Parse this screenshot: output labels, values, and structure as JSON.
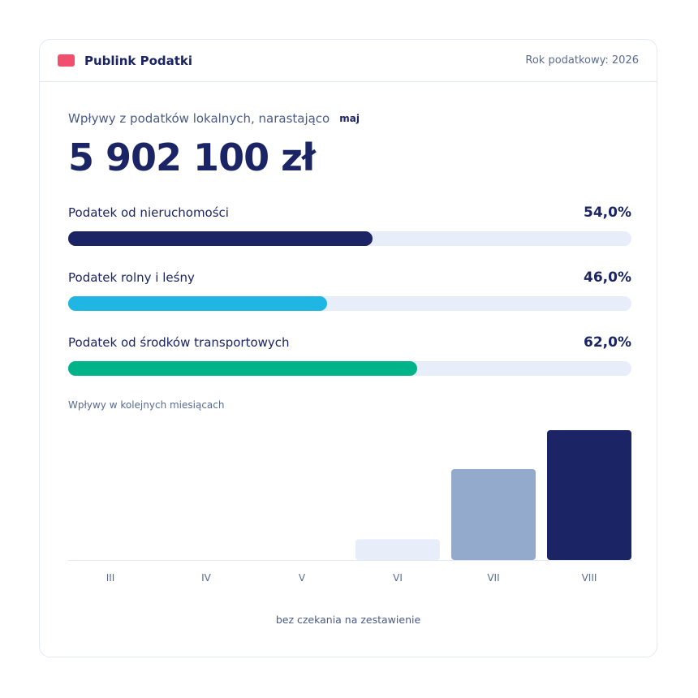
{
  "header": {
    "brand": "Publink Podatki",
    "tax_year": "Rok podatkowy: 2026"
  },
  "summary": {
    "label": "Wpływy z podatków lokalnych, narastająco",
    "month": "maj",
    "total": "5 902 100 zł"
  },
  "taxes": [
    {
      "name": "Podatek od nieruchomości",
      "percent_label": "54,0%",
      "percent": 54.0,
      "color": "#1b2566"
    },
    {
      "name": "Podatek rolny i leśny",
      "percent_label": "46,0%",
      "percent": 46.0,
      "color": "#1fb6e4"
    },
    {
      "name": "Podatek od środków transportowych",
      "percent_label": "62,0%",
      "percent": 62.0,
      "color": "#00b388"
    }
  ],
  "chart_title": "Wpływy w kolejnych miesiącach",
  "chart_data": {
    "type": "bar",
    "categories": [
      "III",
      "IV",
      "V",
      "VI",
      "VII",
      "VIII"
    ],
    "values": [
      0,
      0,
      0,
      16,
      70,
      100
    ],
    "ylim": [
      0,
      100
    ],
    "colors": [
      "#e8eef9",
      "#e8eef9",
      "#e8eef9",
      "#e8eef9",
      "#94aacd",
      "#1b2566"
    ],
    "grid": false
  },
  "footer_note": "bez czekania na zestawienie"
}
